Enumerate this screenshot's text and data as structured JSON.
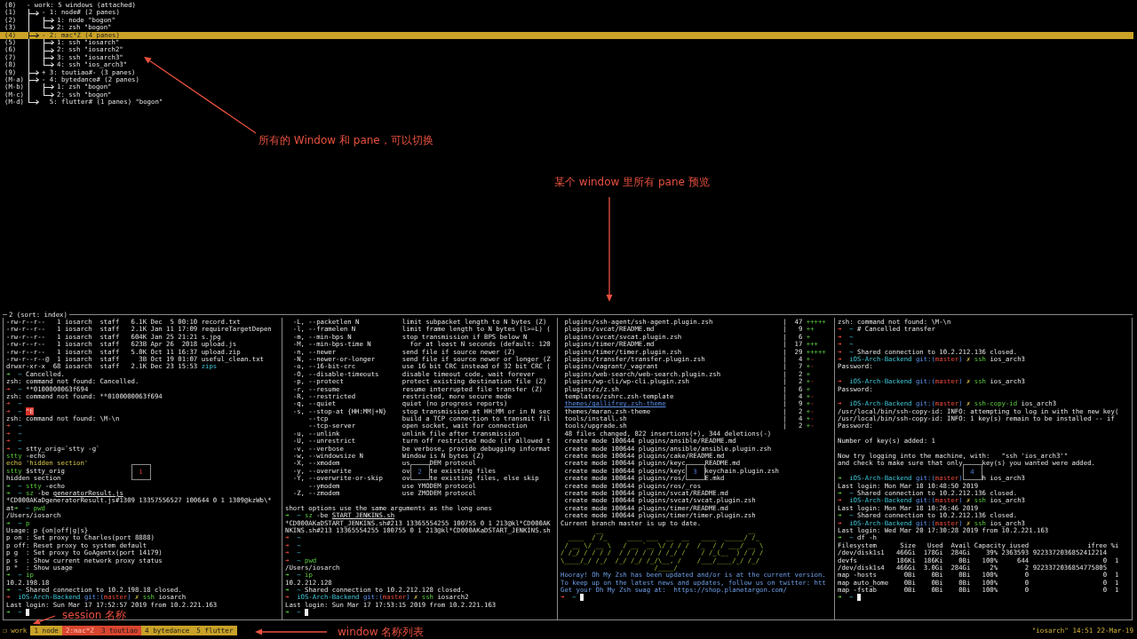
{
  "tree": {
    "key": "(0)",
    "label": "- work: 5 windows (attached)",
    "selected": false,
    "children": [
      {
        "key": "(1)",
        "label": "- 1: node# (2 panes)",
        "selected": false,
        "children": [
          {
            "key": "(2)",
            "label": "1: node \"bogon\"",
            "selected": false
          },
          {
            "key": "(3)",
            "label": "2: zsh \"bogon\"",
            "selected": false
          }
        ]
      },
      {
        "key": "(4)",
        "label": "- 2: mac*Z (4 panes)",
        "selected": true,
        "children": [
          {
            "key": "(5)",
            "label": "1: ssh \"iosarch\"",
            "selected": false
          },
          {
            "key": "(6)",
            "label": "2: ssh \"iosarch2\"",
            "selected": false
          },
          {
            "key": "(7)",
            "label": "3: ssh \"iosarch3\"",
            "selected": false
          },
          {
            "key": "(8)",
            "label": "4: ssh \"ios_arch3\"",
            "selected": false
          }
        ]
      },
      {
        "key": "(9)",
        "label": "+ 3: toutiao#- (3 panes)",
        "selected": false
      },
      {
        "key": "(M-a)",
        "label": "- 4: bytedance# (2 panes)",
        "selected": false,
        "children": [
          {
            "key": "(M-b)",
            "label": "1: zsh \"bogon\"",
            "selected": false
          },
          {
            "key": "(M-c)",
            "label": "2: ssh \"bogon\"",
            "selected": false
          }
        ]
      },
      {
        "key": "(M-d)",
        "label": "  5: flutter# (1 panes) \"bogon\"",
        "selected": false
      }
    ]
  },
  "annotations": [
    {
      "text": "所有的 Window 和 pane，可以切换"
    },
    {
      "text": "某个 window 里所有 pane 预览"
    },
    {
      "text": "session 名称"
    },
    {
      "text": "window 名称列表"
    }
  ],
  "preview": {
    "title": "2 (sort: index)",
    "panes": [
      {
        "number": "1",
        "selected": true,
        "lines": [
          "-rw-r--r--   1 iosarch  staff   6.1K Dec  5 00:10 record.txt",
          "-rw-r--r--   1 iosarch  staff   2.1K Jan 11 17:09 requireTargetDepen",
          "-rw-r--r--   1 iosarch  staff   604K Jan 25 21:21 s.jpg",
          "-rw-r--r--   1 iosarch  staff   623B Apr 26  2018 upload.js",
          "-rw-r--r--   1 iosarch  staff   5.0K Oct 11 16:37 upload.zip",
          "-rw-r--r--@  1 iosarch  staff     3B Oct 19 01:07 useful_clean.txt",
          [
            "drwxr-xr-x  68 iosarch  staff   2.1K Dec 23 15:53 ",
            {
              "kind": "cyan",
              "text": "zips"
            }
          ],
          [
            {
              "kind": "green",
              "text": "➜"
            },
            {
              "kind": "cyan",
              "text": "  ~"
            },
            " Cancelled."
          ],
          "zsh: command not found: Cancelled.",
          [
            {
              "kind": "red",
              "text": "➜"
            },
            {
              "kind": "cyan",
              "text": "  ~"
            },
            " **0100000063f694"
          ],
          "zsh: command not found: **0100000063f694",
          [
            {
              "kind": "red",
              "text": "➜"
            },
            {
              "kind": "cyan",
              "text": "  ~"
            }
          ],
          [
            {
              "kind": "red",
              "text": "➜"
            },
            {
              "kind": "cyan",
              "text": "  ~ "
            },
            {
              "kind": "highlight",
              "text": "^E"
            }
          ],
          "zsh: command not found: \\M-\\n",
          [
            {
              "kind": "red",
              "text": "➜"
            },
            {
              "kind": "cyan",
              "text": "  ~"
            }
          ],
          [
            {
              "kind": "red",
              "text": "➜"
            },
            {
              "kind": "cyan",
              "text": "  ~"
            }
          ],
          [
            {
              "kind": "red",
              "text": "➜"
            },
            {
              "kind": "cyan",
              "text": "  ~"
            }
          ],
          [
            {
              "kind": "red",
              "text": "➜"
            },
            {
              "kind": "cyan",
              "text": "  ~"
            },
            " stty_orig=`stty -g`"
          ],
          [
            {
              "kind": "green",
              "text": "stty"
            },
            " -echo"
          ],
          [
            {
              "kind": "yellow",
              "text": "echo 'hidden section'"
            }
          ],
          [
            {
              "kind": "green",
              "text": "stty"
            },
            " $stty_orig"
          ],
          "hidden section",
          [
            {
              "kind": "green",
              "text": "➜"
            },
            {
              "kind": "cyan",
              "text": "  ~"
            },
            {
              "kind": "green",
              "text": " stty"
            },
            " -echo"
          ],
          [
            {
              "kind": "green",
              "text": "➜"
            },
            {
              "kind": "cyan",
              "text": "  ~"
            },
            {
              "kind": "green",
              "text": " sz"
            },
            " -be ",
            {
              "kind": "underline",
              "text": "generatorResult.js"
            }
          ],
          "*CD000AKaDgeneratorResult.js#1309 13357556527 100644 0 1 1309@kzWb\\*",
          [
            "at",
            {
              "kind": "green",
              "text": "➜"
            },
            {
              "kind": "cyan",
              "text": "  ~"
            },
            {
              "kind": "green",
              "text": " pwd"
            }
          ],
          "/Users/iosarch",
          [
            {
              "kind": "green",
              "text": "➜"
            },
            {
              "kind": "cyan",
              "text": "  ~"
            },
            {
              "kind": "green",
              "text": " p"
            }
          ],
          "Usage: p {on|off|g|s}",
          "p on : Set proxy to Charles(port 8888)",
          "p off: Reset proxy to system default",
          "p g  : Set proxy to GoAgentx(port 14179)",
          "p s  : Show current network proxy status",
          "p *  : Show usage",
          [
            {
              "kind": "green",
              "text": "➜"
            },
            {
              "kind": "cyan",
              "text": "  ~"
            },
            {
              "kind": "green",
              "text": " ip"
            }
          ],
          "10.2.198.18",
          [
            {
              "kind": "green",
              "text": "➜"
            },
            {
              "kind": "cyan",
              "text": "  ~"
            },
            " Shared connection to 10.2.198.18 closed."
          ],
          [
            {
              "kind": "red",
              "text": "➜"
            },
            {
              "kind": "cyan",
              "text": "  iOS-Arch-Backend"
            },
            {
              "kind": "blue",
              "text": " git:("
            },
            {
              "kind": "red",
              "text": "master"
            },
            {
              "kind": "blue",
              "text": ")"
            },
            {
              "kind": "yellow",
              "text": " ✗"
            },
            {
              "kind": "green",
              "text": " ssh"
            },
            " iosarch"
          ],
          "Last login: Sun Mar 17 17:52:57 2019 from 10.2.221.163",
          [
            {
              "kind": "green",
              "text": "➜"
            },
            {
              "kind": "cyan",
              "text": "  ~"
            },
            {
              "kind": "cursor"
            }
          ]
        ]
      },
      {
        "number": "2",
        "selected": false,
        "lines": [
          [
            {
              "kind": "option",
              "text": "  -L, --packetlen N"
            },
            "limit subpacket length to N bytes (Z)"
          ],
          [
            {
              "kind": "option",
              "text": "  -l, --framelen N"
            },
            "limit frame length to N bytes (l>=L) ("
          ],
          [
            {
              "kind": "option",
              "text": "  -m, --min-bps N"
            },
            "stop transmission if BPS below N"
          ],
          [
            {
              "kind": "option",
              "text": "  -M, --min-bps-time N"
            },
            "  for at least N seconds (default: 120"
          ],
          [
            {
              "kind": "option",
              "text": "  -n, --newer"
            },
            "send file if source newer (Z)"
          ],
          [
            {
              "kind": "option",
              "text": "  -N, --newer-or-longer"
            },
            "send file if source newer or longer (Z"
          ],
          [
            {
              "kind": "option",
              "text": "  -o, --16-bit-crc"
            },
            "use 16 bit CRC instead of 32 bit CRC ("
          ],
          [
            {
              "kind": "option",
              "text": "  -O, --disable-timeouts"
            },
            "disable timeout code, wait forever"
          ],
          [
            {
              "kind": "option",
              "text": "  -p, --protect"
            },
            "protect existing destination file (Z)"
          ],
          [
            {
              "kind": "option",
              "text": "  -r, --resume"
            },
            "resume interrupted file transfer (Z)"
          ],
          [
            {
              "kind": "option",
              "text": "  -R, --restricted"
            },
            "restricted, more secure mode"
          ],
          [
            {
              "kind": "option",
              "text": "  -q, --quiet"
            },
            "quiet (no progress reports)"
          ],
          [
            {
              "kind": "option",
              "text": "  -s, --stop-at {HH:MM|+N}"
            },
            "stop transmission at HH:MM or in N sec"
          ],
          [
            {
              "kind": "option",
              "text": "      --tcp"
            },
            "build a TCP connection to transmit fil"
          ],
          [
            {
              "kind": "option",
              "text": "      --tcp-server"
            },
            "open socket, wait for connection"
          ],
          [
            {
              "kind": "option",
              "text": "  -u, --unlink"
            },
            "unlink file after transmission"
          ],
          [
            {
              "kind": "option",
              "text": "  -U, --unrestrict"
            },
            "turn off restricted mode (if allowed t"
          ],
          [
            {
              "kind": "option",
              "text": "  -v, --verbose"
            },
            "be verbose, provide debugging informat"
          ],
          [
            {
              "kind": "option",
              "text": "  -w, --windowsize N"
            },
            "Window is N bytes (Z)"
          ],
          [
            {
              "kind": "option",
              "text": "  -X, --xmodem"
            },
            "us",
            {
              "kind": "gap"
            },
            "DEM protocol"
          ],
          [
            {
              "kind": "option",
              "text": "  -y, --overwrite"
            },
            "ov",
            {
              "kind": "gap"
            },
            "te existing files"
          ],
          [
            {
              "kind": "option",
              "text": "  -Y, --overwrite-or-skip"
            },
            "ov",
            {
              "kind": "gap"
            },
            "te existing files, else skip"
          ],
          [
            {
              "kind": "option",
              "text": "      --ymodem"
            },
            "use YMODEM protocol"
          ],
          [
            {
              "kind": "option",
              "text": "  -Z, --zmodem"
            },
            "use ZMODEM protocol"
          ],
          {
            "kind": "blank"
          },
          "short options use the same arguments as the long ones",
          [
            {
              "kind": "green",
              "text": "➜"
            },
            {
              "kind": "cyan",
              "text": "  ~"
            },
            {
              "kind": "green",
              "text": " sz"
            },
            " -be ",
            {
              "kind": "underline",
              "text": "START_JENKINS.sh"
            }
          ],
          "*CD000AKaDSTART_JENKINS.sh#213 13365554255 100755 0 1 213@kl*CD000AK",
          "NKINS.sh#213 13365554255 100755 0 1 213@kl*CD000AKaDSTART_JENKINS.sh",
          [
            {
              "kind": "red",
              "text": "➜"
            },
            {
              "kind": "cyan",
              "text": "  ~"
            }
          ],
          [
            {
              "kind": "red",
              "text": "➜"
            },
            {
              "kind": "cyan",
              "text": "  ~"
            }
          ],
          [
            {
              "kind": "red",
              "text": "➜"
            },
            {
              "kind": "cyan",
              "text": "  ~"
            }
          ],
          [
            {
              "kind": "red",
              "text": "➜"
            },
            {
              "kind": "cyan",
              "text": "  ~"
            },
            {
              "kind": "green",
              "text": " pwd"
            }
          ],
          "/Users/iosarch",
          [
            {
              "kind": "green",
              "text": "➜"
            },
            {
              "kind": "cyan",
              "text": "  ~"
            },
            {
              "kind": "green",
              "text": " ip"
            }
          ],
          "10.2.212.128",
          [
            {
              "kind": "green",
              "text": "➜"
            },
            {
              "kind": "cyan",
              "text": "  ~"
            },
            " Shared connection to 10.2.212.128 closed."
          ],
          [
            {
              "kind": "red",
              "text": "➜"
            },
            {
              "kind": "cyan",
              "text": "  iOS-Arch-Backend"
            },
            {
              "kind": "blue",
              "text": " git:("
            },
            {
              "kind": "red",
              "text": "master"
            },
            {
              "kind": "blue",
              "text": ")"
            },
            {
              "kind": "yellow",
              "text": " ✗"
            },
            {
              "kind": "green",
              "text": " ssh"
            },
            " iosarch2"
          ],
          "Last login: Sun Mar 17 17:53:15 2019 from 10.2.221.163",
          [
            {
              "kind": "green",
              "text": "➜"
            },
            {
              "kind": "cyan",
              "text": "  ~"
            },
            {
              "kind": "cursor"
            }
          ]
        ]
      },
      {
        "number": "3",
        "selected": false,
        "lines": [
          [
            {
              "kind": "path",
              "text": " plugins/ssh-agent/ssh-agent.plugin.zsh"
            },
            "|",
            {
              "kind": "count",
              "text": "47"
            },
            {
              "kind": "green",
              "text": "+++++"
            }
          ],
          [
            {
              "kind": "path",
              "text": " plugins/svcat/README.md"
            },
            "|",
            {
              "kind": "count",
              "text": "9"
            },
            {
              "kind": "green",
              "text": "++"
            }
          ],
          [
            {
              "kind": "path",
              "text": " plugins/svcat/svcat.plugin.zsh"
            },
            "|",
            {
              "kind": "count",
              "text": "6"
            },
            {
              "kind": "green",
              "text": "+"
            }
          ],
          [
            {
              "kind": "path",
              "text": " plugins/timer/README.md"
            },
            "|",
            {
              "kind": "count",
              "text": "17"
            },
            {
              "kind": "green",
              "text": "+++"
            }
          ],
          [
            {
              "kind": "path",
              "text": " plugins/timer/timer.plugin.zsh"
            },
            "|",
            {
              "kind": "count",
              "text": "29"
            },
            {
              "kind": "green",
              "text": "+++++"
            }
          ],
          [
            {
              "kind": "path",
              "text": " plugins/transfer/transfer.plugin.zsh"
            },
            "|",
            {
              "kind": "count",
              "text": "4"
            },
            {
              "kind": "green",
              "text": "+"
            },
            {
              "kind": "red",
              "text": "-"
            }
          ],
          [
            {
              "kind": "path",
              "text": " plugins/vagrant/_vagrant"
            },
            "|",
            {
              "kind": "count",
              "text": "7"
            },
            {
              "kind": "green",
              "text": "+"
            },
            {
              "kind": "red",
              "text": "-"
            }
          ],
          [
            {
              "kind": "path",
              "text": " plugins/web-search/web-search.plugin.zsh"
            },
            "|",
            {
              "kind": "count",
              "text": "2"
            },
            {
              "kind": "green",
              "text": "+"
            }
          ],
          [
            {
              "kind": "path",
              "text": " plugins/wp-cli/wp-cli.plugin.zsh"
            },
            "|",
            {
              "kind": "count",
              "text": "2"
            },
            {
              "kind": "green",
              "text": "+"
            },
            {
              "kind": "red",
              "text": "-"
            }
          ],
          [
            {
              "kind": "path",
              "text": " plugins/z/z.sh"
            },
            "|",
            {
              "kind": "count",
              "text": "6"
            },
            {
              "kind": "green",
              "text": "+"
            }
          ],
          [
            {
              "kind": "path",
              "text": " templates/zshrc.zsh-template"
            },
            "|",
            {
              "kind": "count",
              "text": "4"
            },
            {
              "kind": "green",
              "text": "+"
            },
            {
              "kind": "red",
              "text": "-"
            }
          ],
          [
            {
              "kind": "linkpath",
              "text": "themes/gallifrey.zsh-theme"
            },
            "|",
            {
              "kind": "count",
              "text": "9"
            },
            {
              "kind": "green",
              "text": "+"
            },
            {
              "kind": "red",
              "text": "-"
            }
          ],
          [
            {
              "kind": "path",
              "text": " themes/maran.zsh-theme"
            },
            "|",
            {
              "kind": "count",
              "text": "2"
            },
            {
              "kind": "green",
              "text": "+"
            },
            {
              "kind": "red",
              "text": "-"
            }
          ],
          [
            {
              "kind": "path",
              "text": " tools/install.sh"
            },
            "|",
            {
              "kind": "count",
              "text": "4"
            },
            {
              "kind": "green",
              "text": "+"
            },
            {
              "kind": "red",
              "text": "-"
            }
          ],
          [
            {
              "kind": "path",
              "text": " tools/upgrade.sh"
            },
            "|",
            {
              "kind": "count",
              "text": "2"
            },
            {
              "kind": "green",
              "text": "+"
            },
            {
              "kind": "red",
              "text": "-"
            }
          ],
          " 48 files changed, 822 insertions(+), 344 deletions(-)",
          " create mode 100644 plugins/ansible/README.md",
          " create mode 100644 plugins/ansible/ansible.plugin.zsh",
          " create mode 100644 plugins/cake/README.md",
          [
            " create mode 100644 plugins/keyc",
            {
              "kind": "gap"
            },
            "README.md"
          ],
          [
            " create mode 100644 plugins/keyc",
            {
              "kind": "gap"
            },
            "keychain.plugin.zsh"
          ],
          [
            " create mode 100644 plugins/ros/",
            {
              "kind": "gap"
            },
            "E.mkd"
          ],
          " create mode 100644 plugins/ros/_ros",
          " create mode 100644 plugins/svcat/README.md",
          " create mode 100644 plugins/svcat/svcat.plugin.zsh",
          " create mode 100644 plugins/timer/README.md",
          " create mode 100644 plugins/timer/timer.plugin.zsh",
          "Current branch master is up to date.",
          {
            "kind": "art",
            "lines": [
              "         __                                     __",
              "  ____  / /_     ____ ___  __  __   ____  _____/ /_",
              " / __ \\/ __ \\   / __ `__ \\/ / / /  /_  / / ___/ __ \\",
              "/ /_/ / / / /  / / / / / / /_/ /    / /_(__  ) / / /",
              "\\____/_/ /_/  /_/ /_/ /_/\\__, /    /___/____/_/ /_/",
              "                        /____/"
            ]
          },
          [
            {
              "kind": "info",
              "text": "Hooray! Oh My Zsh has been updated and/or is at the current version."
            }
          ],
          [
            {
              "kind": "info",
              "text": "To keep up on the latest news and updates, follow us on twitter: htt"
            }
          ],
          [
            {
              "kind": "info",
              "text": "Get your Oh My Zsh swag at:  https://shop.planetargon.com/"
            }
          ],
          [
            {
              "kind": "red",
              "text": "➜"
            },
            {
              "kind": "cyan",
              "text": "  ~"
            },
            {
              "kind": "cursor"
            }
          ]
        ]
      },
      {
        "number": "4",
        "selected": false,
        "lines": [
          "zsh: command not found: \\M-\\n",
          [
            {
              "kind": "red",
              "text": "➜"
            },
            {
              "kind": "cyan",
              "text": "  ~"
            },
            " # Cancelled transfer"
          ],
          [
            {
              "kind": "red",
              "text": "➜"
            },
            {
              "kind": "cyan",
              "text": "  ~"
            }
          ],
          [
            {
              "kind": "red",
              "text": "➜"
            },
            {
              "kind": "cyan",
              "text": "  ~"
            }
          ],
          [
            {
              "kind": "red",
              "text": "➜"
            },
            {
              "kind": "cyan",
              "text": "  ~"
            },
            " Shared connection to 10.2.212.136 closed."
          ],
          [
            {
              "kind": "red",
              "text": "➜"
            },
            {
              "kind": "cyan",
              "text": "  iOS-Arch-Backend"
            },
            {
              "kind": "blue",
              "text": " git:("
            },
            {
              "kind": "red",
              "text": "master"
            },
            {
              "kind": "blue",
              "text": ")"
            },
            {
              "kind": "yellow",
              "text": " ✗"
            },
            {
              "kind": "green",
              "text": " ssh"
            },
            " ios_arch3"
          ],
          "Password:",
          {
            "kind": "blank"
          },
          [
            {
              "kind": "red",
              "text": "➜"
            },
            {
              "kind": "cyan",
              "text": "  iOS-Arch-Backend"
            },
            {
              "kind": "blue",
              "text": " git:("
            },
            {
              "kind": "red",
              "text": "master"
            },
            {
              "kind": "blue",
              "text": ")"
            },
            {
              "kind": "yellow",
              "text": " ✗"
            },
            {
              "kind": "green",
              "text": " ssh"
            },
            " ios_arch3"
          ],
          "Password:",
          {
            "kind": "blank"
          },
          [
            {
              "kind": "red",
              "text": "➜"
            },
            {
              "kind": "cyan",
              "text": "  iOS-Arch-Backend"
            },
            {
              "kind": "blue",
              "text": " git:("
            },
            {
              "kind": "red",
              "text": "master"
            },
            {
              "kind": "blue",
              "text": ")"
            },
            {
              "kind": "yellow",
              "text": " ✗"
            },
            {
              "kind": "green",
              "text": " ssh-copy-id"
            },
            " ios_arch3"
          ],
          "/usr/local/bin/ssh-copy-id: INFO: attempting to log in with the new key(",
          "/usr/local/bin/ssh-copy-id: INFO: 1 key(s) remain to be installed -- if",
          "Password:",
          {
            "kind": "blank"
          },
          "Number of key(s) added: 1",
          {
            "kind": "blank"
          },
          "Now try logging into the machine, with:   \"ssh 'ios_arch3'\"",
          [
            "and check to make sure that only",
            {
              "kind": "gap"
            },
            "key(s) you wanted were added."
          ],
          {
            "kind": "blank"
          },
          [
            {
              "kind": "green",
              "text": "➜"
            },
            {
              "kind": "cyan",
              "text": "  iOS-Arch-Backend"
            },
            {
              "kind": "blue",
              "text": " git:("
            },
            {
              "kind": "red",
              "text": "master"
            },
            {
              "kind": "blue",
              "text": ")"
            },
            {
              "kind": "gap"
            },
            "h ios_arch3"
          ],
          "Last login: Mon Mar 18 10:48:50 2019",
          [
            {
              "kind": "green",
              "text": "➜"
            },
            {
              "kind": "cyan",
              "text": "  ~"
            },
            " Shared connection to 10.2.212.136 closed."
          ],
          [
            {
              "kind": "red",
              "text": "➜"
            },
            {
              "kind": "cyan",
              "text": "  iOS-Arch-Backend"
            },
            {
              "kind": "blue",
              "text": " git:("
            },
            {
              "kind": "red",
              "text": "master"
            },
            {
              "kind": "blue",
              "text": ")"
            },
            {
              "kind": "yellow",
              "text": " ✗"
            },
            {
              "kind": "green",
              "text": " ssh"
            },
            " ios_arch3"
          ],
          "Last login: Mon Mar 18 10:26:46 2019",
          [
            {
              "kind": "green",
              "text": "➜"
            },
            {
              "kind": "cyan",
              "text": "  ~"
            },
            " Shared connection to 10.2.212.136 closed."
          ],
          [
            {
              "kind": "red",
              "text": "➜"
            },
            {
              "kind": "cyan",
              "text": "  iOS-Arch-Backend"
            },
            {
              "kind": "blue",
              "text": " git:("
            },
            {
              "kind": "red",
              "text": "master"
            },
            {
              "kind": "blue",
              "text": ")"
            },
            {
              "kind": "yellow",
              "text": " ✗"
            },
            {
              "kind": "green",
              "text": " ssh"
            },
            " ios_arch3"
          ],
          "Last login: Wed Mar 20 17:30:28 2019 from 10.2.221.163",
          [
            {
              "kind": "green",
              "text": "➜"
            },
            {
              "kind": "cyan",
              "text": "  ~"
            },
            " df -h"
          ],
          "Filesystem      Size   Used  Avail Capacity iused               ifree %i",
          "/dev/disk1s1   466Gi  178Gi  284Gi    39% 2363593 9223372036852412214",
          "devfs          186Ki  186Ki    0Bi   100%     644                   0  1",
          "/dev/disk1s4   466Gi  3.0Gi  284Gi     2%       2 9223372036854775805",
          "map -hosts       0Bi    0Bi    0Bi   100%       0                   0  1",
          "map auto_home    0Bi    0Bi    0Bi   100%       0                   0  1",
          "map -fstab       0Bi    0Bi    0Bi   100%       0                   0  1",
          [
            {
              "kind": "green",
              "text": "➜"
            },
            {
              "kind": "cyan",
              "text": "  ~"
            },
            {
              "kind": "cursor"
            }
          ]
        ]
      }
    ]
  },
  "status_bar": {
    "session": "❐ work",
    "windows": [
      {
        "label": "1 node",
        "selected": false,
        "color": "#c9a227"
      },
      {
        "label": "2:mac*Z",
        "selected": true,
        "color": "#d9452f"
      },
      {
        "label": "3 toutiao",
        "selected": false,
        "color": "#d9452f"
      },
      {
        "label": "4 bytedance",
        "selected": false,
        "color": "#c9a227"
      },
      {
        "label": "5 flutter",
        "selected": false,
        "color": "#c9a227"
      }
    ],
    "right": "\"iosarch\" 14:51 22-Mar-19"
  }
}
